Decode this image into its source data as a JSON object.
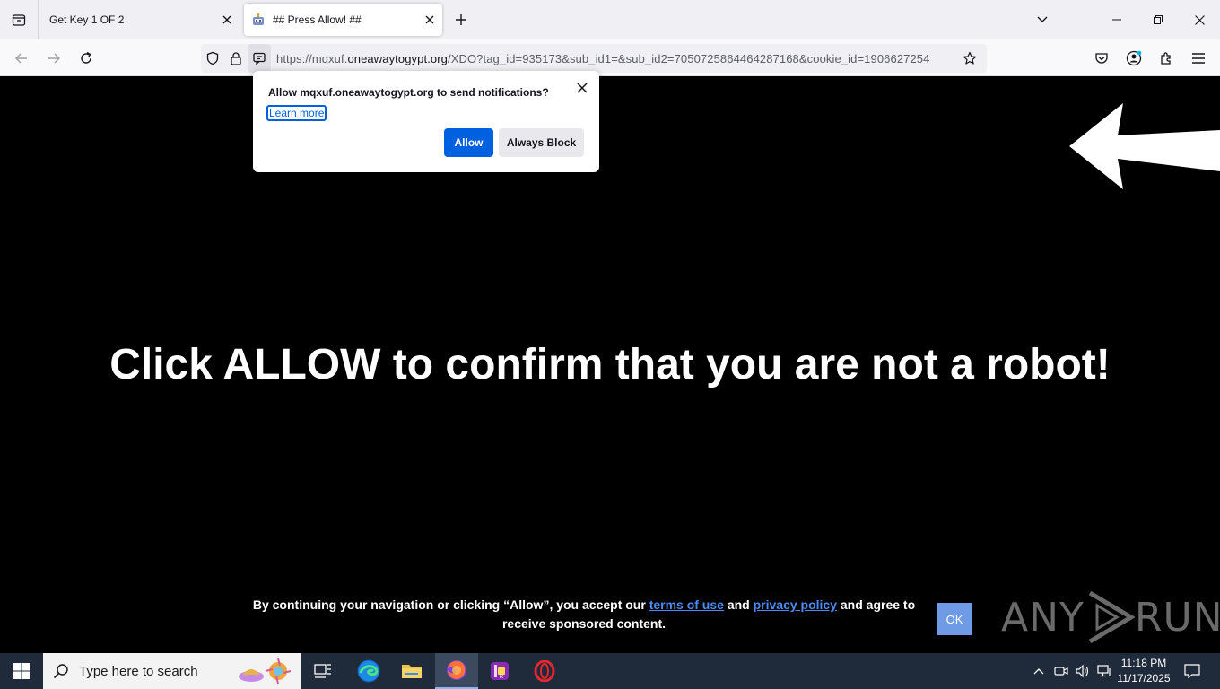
{
  "browser": {
    "tabs": [
      {
        "title": "Get Key 1 OF 2",
        "active": false
      },
      {
        "title": "## Press Allow! ##",
        "active": true
      }
    ],
    "url": {
      "prefix": "https://mqxuf.",
      "domain": "oneawaytogypt.org",
      "path": "/XDO?tag_id=935173&sub_id1=&sub_id2=7050725864464287168&cookie_id=1906627254"
    }
  },
  "popup": {
    "message": "Allow mqxuf.oneawaytogypt.org to send notifications?",
    "learn_more": "Learn more",
    "allow": "Allow",
    "block": "Always Block"
  },
  "page": {
    "headline": "Click ALLOW to confirm that you are not a robot!",
    "consent_part1": "By continuing your navigation or clicking “Allow”, you accept our ",
    "terms_link": "terms of use",
    "consent_part2": " and ",
    "privacy_link": "privacy policy",
    "consent_part3": " and agree to receive sponsored content.",
    "ok": "OK",
    "watermark_left": "ANY",
    "watermark_right": "RUN"
  },
  "taskbar": {
    "search_placeholder": "Type here to search",
    "time": "11:18 PM",
    "date": "11/17/2025"
  },
  "colors": {
    "allow_button": "#0061e0",
    "link_blue": "#4b8bf5",
    "ok_button": "#6f9be6"
  }
}
